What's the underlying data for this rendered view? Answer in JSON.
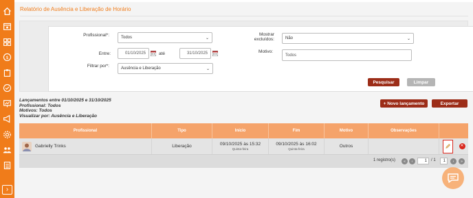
{
  "page": {
    "title": "Relatório de Ausência e Liberação de Horário"
  },
  "filters": {
    "profissional": {
      "label": "Profissional*:",
      "value": "Todos"
    },
    "entre": {
      "label": "Entre:",
      "from": "01/10/2025",
      "separator": "até",
      "to": "31/10/2025"
    },
    "filtrar_por": {
      "label": "Filtrar por*:",
      "value": "Ausência e Liberação"
    },
    "mostrar_excluidos": {
      "label_line1": "Mostrar",
      "label_line2": "excluídos:",
      "value": "Não"
    },
    "motivo": {
      "label": "Motivo:",
      "value": "Todos"
    },
    "search_label": "Pesquisar",
    "clear_label": "Limpar"
  },
  "summary": {
    "line1": "Lançamentos entre 01/10/2025 e 31/10/2025",
    "line2": "Profissional: Todos",
    "line3": "Motivos: Todos",
    "line4": "Visualizar por: Ausência e Liberação"
  },
  "actions": {
    "new_label": "+  Novo lançamento",
    "export_label": "Exportar"
  },
  "grid": {
    "columns": [
      "Profissional",
      "Tipo",
      "Início",
      "Fim",
      "Motivo",
      "Observações"
    ],
    "rows": [
      {
        "profissional": "Gabrielly Trinks",
        "tipo": "Liberação",
        "inicio": "09/10/2025 às 15:32",
        "inicio_dia": "Quinta-feira",
        "fim": "09/10/2025 às 16:02",
        "fim_dia": "Quinta-feira",
        "motivo": "Outros",
        "observacoes": ""
      }
    ],
    "footer": {
      "records": "1 registro(s)",
      "page_current": "1",
      "page_total": "/ 1",
      "page_size": "1"
    }
  },
  "colors": {
    "accent": "#f07c1a",
    "header": "#f5a36a",
    "primary_button": "#9c2d18",
    "secondary_button": "#b5b5b5",
    "delete": "#d9261c"
  }
}
